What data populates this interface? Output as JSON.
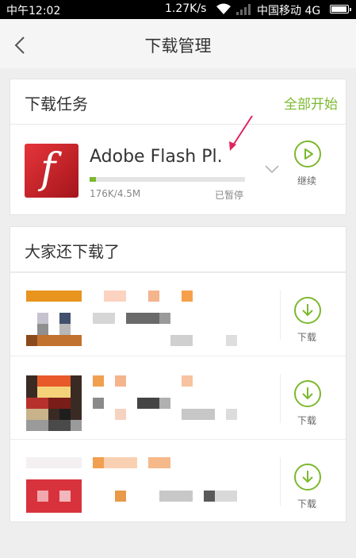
{
  "status_bar": {
    "time": "中午12:02",
    "speed": "1.27K/s",
    "carrier": "中国移动 4G"
  },
  "header": {
    "back_icon": "chevron-left-icon",
    "title": "下载管理"
  },
  "tasks_section": {
    "title": "下载任务",
    "start_all": "全部开始",
    "task": {
      "name": "Adobe Flash Pl.",
      "size": "176K/4.5M",
      "status": "已暂停",
      "progress": 0.04,
      "action_label": "继续",
      "icon": "flash-icon"
    }
  },
  "recommend_section": {
    "title": "大家还下载了",
    "items": [
      {
        "action_label": "下载"
      },
      {
        "action_label": "下载"
      },
      {
        "action_label": "下载"
      }
    ]
  },
  "colors": {
    "accent": "#7cb82f",
    "background": "#eeeeee",
    "annotation": "#e0245e"
  }
}
